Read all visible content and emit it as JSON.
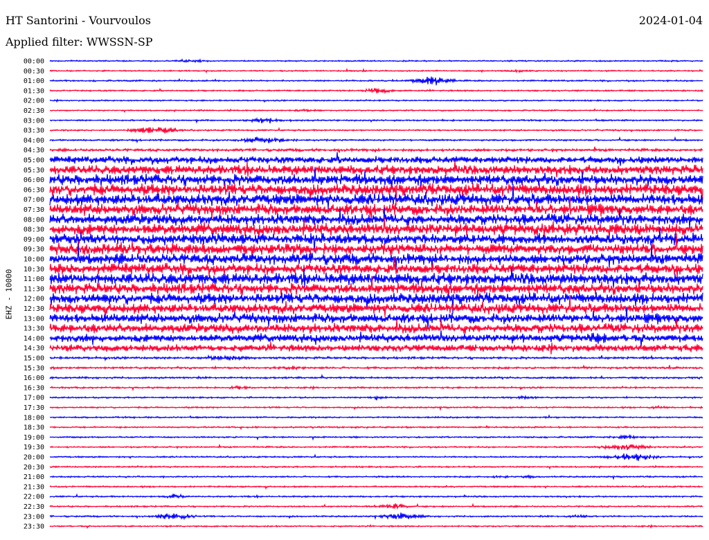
{
  "header": {
    "station": "HT Santorini - Vourvoulos",
    "date": "2024-01-04",
    "filter_label": "Applied filter: WWSSN-SP"
  },
  "chart_data": {
    "type": "line",
    "title": "HT Santorini - Vourvoulos",
    "ylabel": "EHZ - 10000",
    "tick_labels": [
      "00:00",
      "00:30",
      "01:00",
      "01:30",
      "02:00",
      "02:30",
      "03:00",
      "03:30",
      "04:00",
      "04:30",
      "05:00",
      "05:30",
      "06:00",
      "06:30",
      "07:00",
      "07:30",
      "08:00",
      "08:30",
      "09:00",
      "09:30",
      "10:00",
      "10:30",
      "11:00",
      "11:30",
      "12:00",
      "12:30",
      "13:00",
      "13:30",
      "14:00",
      "14:30",
      "15:00",
      "15:30",
      "16:00",
      "16:30",
      "17:00",
      "17:30",
      "18:00",
      "18:30",
      "19:00",
      "19:30",
      "20:00",
      "20:30",
      "21:00",
      "21:30",
      "22:00",
      "22:30",
      "23:00",
      "23:30"
    ],
    "series_colors": [
      "#0000ff",
      "#ff0033"
    ],
    "noise_level": [
      0.35,
      0.35,
      0.4,
      0.4,
      0.35,
      0.35,
      0.4,
      0.4,
      0.45,
      0.7,
      2.0,
      2.6,
      3.0,
      3.2,
      3.2,
      3.0,
      3.0,
      3.2,
      3.0,
      3.0,
      3.0,
      3.0,
      3.2,
      3.0,
      3.0,
      2.8,
      2.6,
      2.6,
      2.2,
      2.0,
      0.6,
      0.55,
      0.5,
      0.45,
      0.4,
      0.4,
      0.4,
      0.4,
      0.4,
      0.4,
      0.4,
      0.4,
      0.4,
      0.4,
      0.4,
      0.4,
      0.4,
      0.4
    ],
    "events": [
      {
        "trace": 0,
        "t": 0.22,
        "amp": 0.6,
        "dur": 0.03
      },
      {
        "trace": 1,
        "t": 0.72,
        "amp": 0.8,
        "dur": 0.02
      },
      {
        "trace": 1,
        "t": 0.48,
        "amp": 1.2,
        "dur": 0.005
      },
      {
        "trace": 2,
        "t": 0.585,
        "amp": 2.8,
        "dur": 0.04
      },
      {
        "trace": 3,
        "t": 0.5,
        "amp": 1.6,
        "dur": 0.03
      },
      {
        "trace": 5,
        "t": 0.39,
        "amp": 0.6,
        "dur": 0.02
      },
      {
        "trace": 6,
        "t": 0.33,
        "amp": 1.6,
        "dur": 0.03
      },
      {
        "trace": 7,
        "t": 0.16,
        "amp": 2.2,
        "dur": 0.05
      },
      {
        "trace": 8,
        "t": 0.33,
        "amp": 1.8,
        "dur": 0.05
      },
      {
        "trace": 28,
        "t": 0.84,
        "amp": 1.8,
        "dur": 0.02
      },
      {
        "trace": 30,
        "t": 0.27,
        "amp": 1.0,
        "dur": 0.04
      },
      {
        "trace": 31,
        "t": 0.37,
        "amp": 0.8,
        "dur": 0.03
      },
      {
        "trace": 33,
        "t": 0.29,
        "amp": 0.8,
        "dur": 0.02
      },
      {
        "trace": 34,
        "t": 0.5,
        "amp": 0.6,
        "dur": 0.02
      },
      {
        "trace": 34,
        "t": 0.72,
        "amp": 0.8,
        "dur": 0.03
      },
      {
        "trace": 35,
        "t": 0.93,
        "amp": 0.6,
        "dur": 0.02
      },
      {
        "trace": 38,
        "t": 0.88,
        "amp": 1.2,
        "dur": 0.03
      },
      {
        "trace": 39,
        "t": 0.88,
        "amp": 1.8,
        "dur": 0.05
      },
      {
        "trace": 40,
        "t": 0.89,
        "amp": 2.0,
        "dur": 0.05
      },
      {
        "trace": 42,
        "t": 0.73,
        "amp": 0.6,
        "dur": 0.02
      },
      {
        "trace": 42,
        "t": 0.69,
        "amp": 0.5,
        "dur": 0.02
      },
      {
        "trace": 44,
        "t": 0.19,
        "amp": 1.5,
        "dur": 0.02
      },
      {
        "trace": 45,
        "t": 0.53,
        "amp": 1.6,
        "dur": 0.03
      },
      {
        "trace": 46,
        "t": 0.19,
        "amp": 2.0,
        "dur": 0.04
      },
      {
        "trace": 46,
        "t": 0.54,
        "amp": 2.0,
        "dur": 0.04
      },
      {
        "trace": 46,
        "t": 0.81,
        "amp": 0.6,
        "dur": 0.03
      }
    ]
  }
}
